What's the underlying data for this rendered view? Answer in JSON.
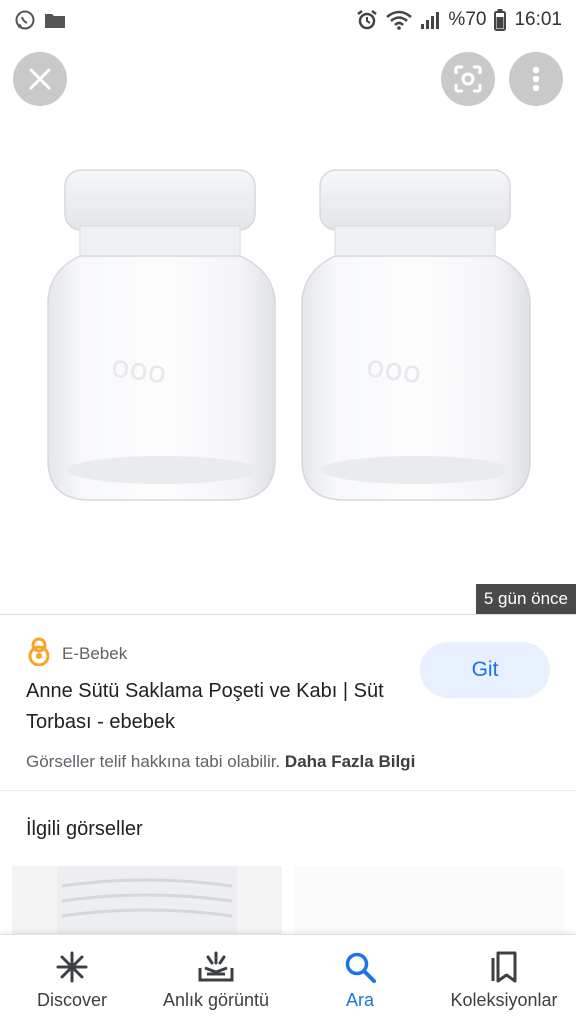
{
  "status_bar": {
    "battery": "%70",
    "time": "16:01"
  },
  "viewer": {
    "date_badge": "5 gün önce"
  },
  "result": {
    "source": "E-Bebek",
    "title": "Anne Sütü Saklama Poşeti ve Kabı | Süt Torbası - ebebek",
    "visit_label": "Git",
    "copyright_text": "Görseller telif hakkına tabi olabilir.",
    "more_info_link": "Daha Fazla Bilgi"
  },
  "related": {
    "heading": "İlgili görseller"
  },
  "bottom_nav": {
    "items": [
      {
        "label": "Discover",
        "icon": "asterisk-icon"
      },
      {
        "label": "Anlık görüntü",
        "icon": "snapshot-icon"
      },
      {
        "label": "Ara",
        "icon": "search-icon"
      },
      {
        "label": "Koleksiyonlar",
        "icon": "collections-icon"
      }
    ],
    "active_index": 2
  },
  "colors": {
    "accent": "#1a73e8",
    "visit_button_bg": "#e8f0fe",
    "badge_bg": "#4a4a4a"
  }
}
